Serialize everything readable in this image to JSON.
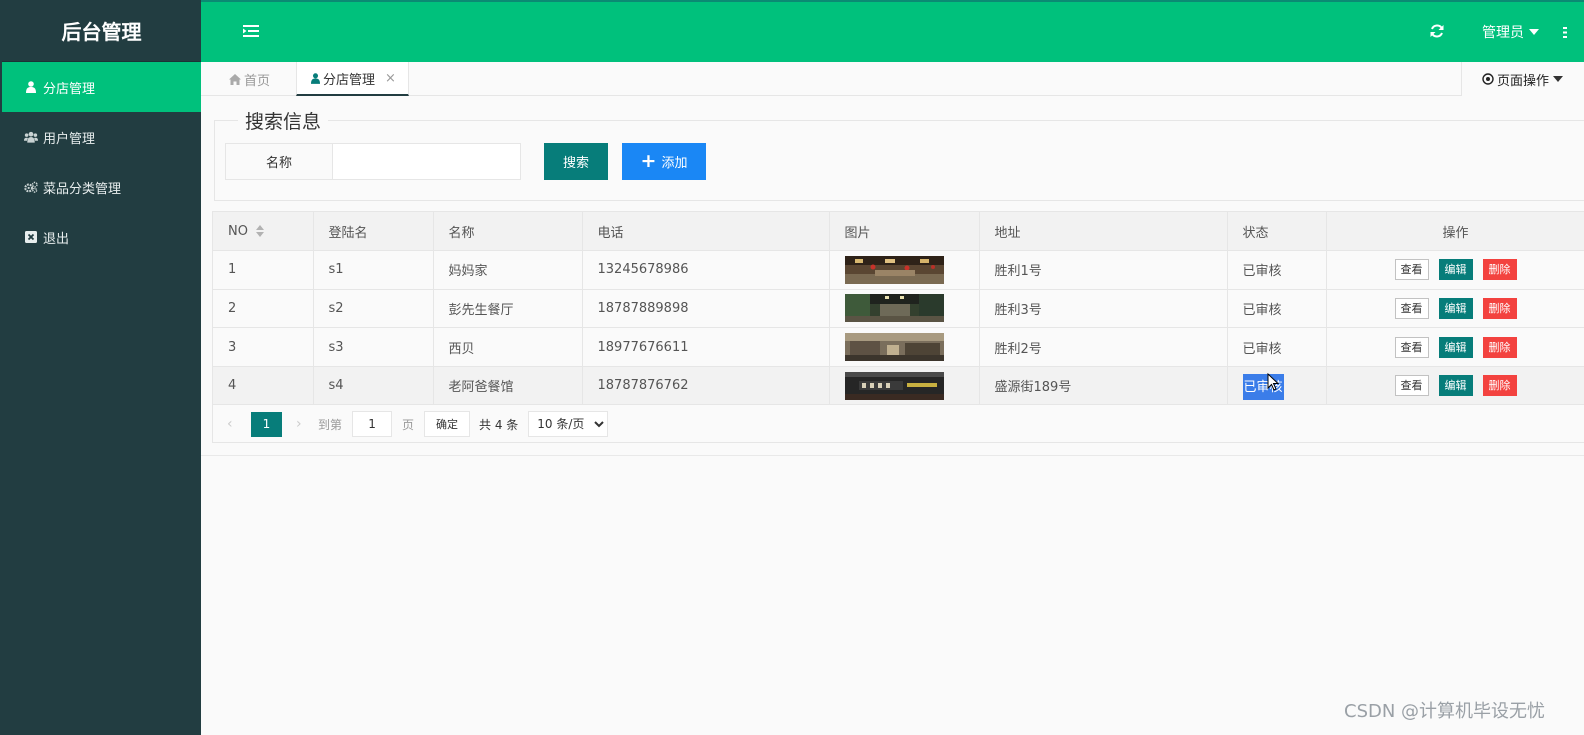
{
  "app": {
    "title": "后台管理"
  },
  "sidebar": {
    "items": [
      {
        "label": "分店管理",
        "icon": "user-icon",
        "active": true
      },
      {
        "label": "用户管理",
        "icon": "users-icon",
        "active": false
      },
      {
        "label": "菜品分类管理",
        "icon": "cogs-icon",
        "active": false
      },
      {
        "label": "退出",
        "icon": "close-box-icon",
        "active": false
      }
    ]
  },
  "header": {
    "admin_label": "管理员"
  },
  "tabs": {
    "home_label": "首页",
    "active_label": "分店管理",
    "close_glyph": "×",
    "page_ops_label": "页面操作"
  },
  "search": {
    "legend": "搜索信息",
    "field_label": "名称",
    "field_value": "",
    "search_button": "搜索",
    "add_button": "添加"
  },
  "table": {
    "columns": [
      "NO",
      "登陆名",
      "名称",
      "电话",
      "图片",
      "地址",
      "状态",
      "操作"
    ],
    "rows": [
      {
        "no": "1",
        "login": "s1",
        "name": "妈妈家",
        "phone": "13245678986",
        "address": "胜利1号",
        "status": "已审核"
      },
      {
        "no": "2",
        "login": "s2",
        "name": "彭先生餐厅",
        "phone": "18787889898",
        "address": "胜利3号",
        "status": "已审核"
      },
      {
        "no": "3",
        "login": "s3",
        "name": "西贝",
        "phone": "18977676611",
        "address": "胜利2号",
        "status": "已审核"
      },
      {
        "no": "4",
        "login": "s4",
        "name": "老阿爸餐馆",
        "phone": "18787876762",
        "address": "盛源街189号",
        "status": "已审核"
      }
    ],
    "actions": {
      "view": "查看",
      "edit": "编辑",
      "delete": "删除"
    }
  },
  "pager": {
    "current_page": "1",
    "goto_label": "到第",
    "goto_value": "1",
    "page_suffix": "页",
    "confirm_label": "确定",
    "total_label": "共 4 条",
    "page_size": "10 条/页"
  },
  "watermark": "CSDN @计算机毕设无忧",
  "colors": {
    "sidebar_bg": "#223d41",
    "accent_green": "#00c17c",
    "teal": "#077d7a",
    "blue": "#1a87f5",
    "danger": "#f3423f"
  }
}
